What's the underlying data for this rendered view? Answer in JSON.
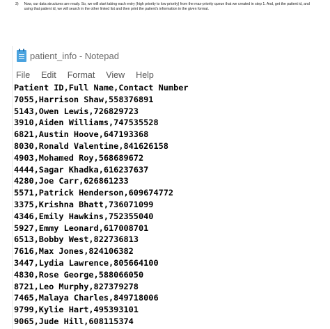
{
  "instruction": {
    "number": "3)",
    "text": "Now, our data structures are ready. So, we will start taking each entry (high priority to low priority) from the max-priority queue that we created in step 1. And, get the patient id, and using that patient id, we will search in the other linked list and then print the patient's information in the given format."
  },
  "window": {
    "title": "patient_info - Notepad",
    "icon": "notepad-icon"
  },
  "menu": [
    "File",
    "Edit",
    "Format",
    "View",
    "Help"
  ],
  "editor": {
    "lines": [
      "Patient ID,Full Name,Contact Number",
      "7055,Harrison Shaw,558376891",
      "5143,Owen Lewis,726829723",
      "3910,Aiden Williams,747535528",
      "6821,Austin Hoove,647193368",
      "8030,Ronald Valentine,841626158",
      "4903,Mohamed Roy,568689672",
      "4444,Sagar Khadka,616237637",
      "4280,Joe Carr,626861233",
      "5571,Patrick Henderson,609674772",
      "3375,Krishna Bhatt,736071099",
      "4346,Emily Hawkins,752355040",
      "5927,Emmy Leonard,617008701",
      "6513,Bobby West,822736813",
      "7616,Max Jones,824106382",
      "3447,Lydia Lawrence,805664100",
      "4830,Rose George,588066050",
      "8721,Leo Murphy,827379278",
      "7465,Malaya Charles,849718006",
      "9799,Kylie Hart,495393101",
      "9065,Jude Hill,608115374"
    ]
  }
}
